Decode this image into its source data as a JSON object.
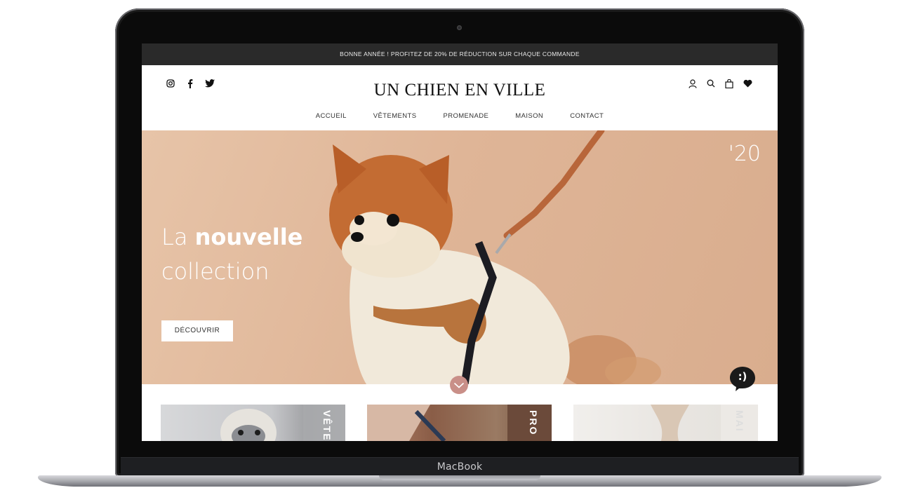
{
  "device": {
    "label": "MacBook"
  },
  "promo": {
    "text": "BONNE ANNÉE ! PROFITEZ DE 20% DE RÉDUCTION SUR CHAQUE COMMANDE"
  },
  "header": {
    "logo": "UN CHIEN EN VILLE",
    "social_icons": [
      "instagram-icon",
      "facebook-icon",
      "twitter-icon"
    ],
    "utility_icons": [
      "account-icon",
      "search-icon",
      "cart-icon",
      "wishlist-icon"
    ]
  },
  "nav": {
    "items": [
      {
        "label": "ACCUEIL"
      },
      {
        "label": "VÊTEMENTS"
      },
      {
        "label": "PROMENADE"
      },
      {
        "label": "MAISON"
      },
      {
        "label": "CONTACT"
      }
    ]
  },
  "hero": {
    "title_regular": "La ",
    "title_bold": "nouvelle",
    "title_line2": "collection",
    "year": "'20",
    "cta_label": "DÉCOUVRIR",
    "chat_label": ":)"
  },
  "tiles": [
    {
      "label": "VÊTE"
    },
    {
      "label": "PRO"
    },
    {
      "label": "MAI"
    }
  ],
  "colors": {
    "promo_bg": "#2a2a2a",
    "hero_bg": "#dfb597",
    "scroll_button": "#c98f88",
    "chat_bubble": "#1a1a1a"
  }
}
